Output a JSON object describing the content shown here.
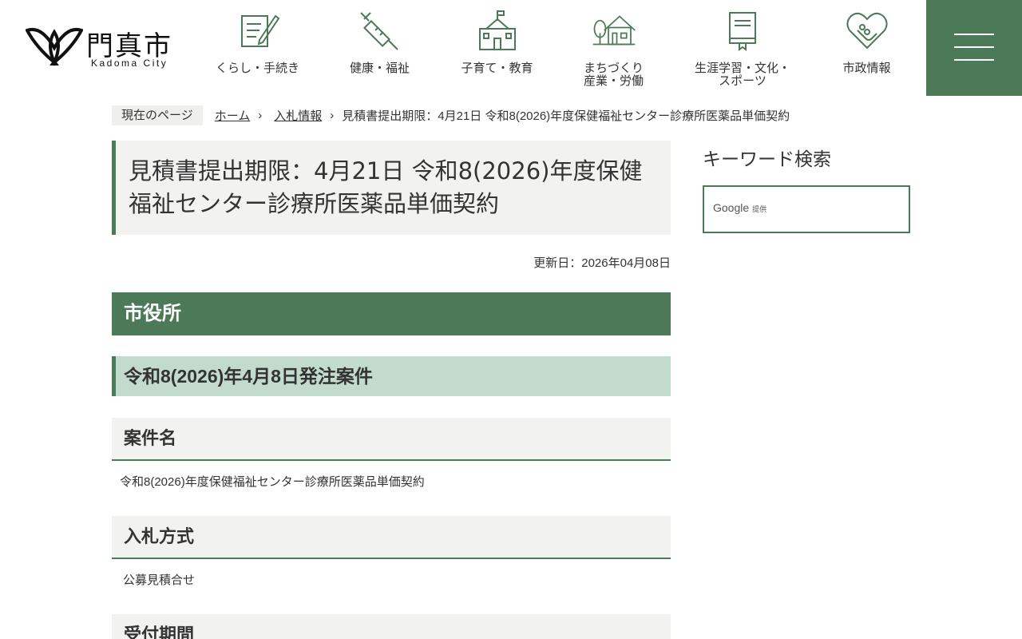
{
  "header": {
    "logo_jp": "門真市",
    "logo_en": "Kadoma City",
    "nav": [
      {
        "label": "くらし・手続き",
        "icon": "form-pen-icon"
      },
      {
        "label": "健康・福祉",
        "icon": "syringe-icon"
      },
      {
        "label": "子育て・教育",
        "icon": "school-icon"
      },
      {
        "label": "まちづくり\n産業・労働",
        "icon": "house-tree-icon"
      },
      {
        "label": "生涯学習・文化・\nスポーツ",
        "icon": "book-icon"
      },
      {
        "label": "市政情報",
        "icon": "heart-handshake-icon"
      }
    ],
    "menu_icon": "hamburger-menu-icon"
  },
  "breadcrumb": {
    "current_label": "現在のページ",
    "home": "ホーム",
    "parent": "入札情報",
    "current": "見積書提出期限：4月21日 令和8(2026)年度保健福祉センター診療所医薬品単価契約",
    "separator": "›"
  },
  "main": {
    "title": "見積書提出期限：4月21日 令和8(2026)年度保健福祉センター診療所医薬品単価契約",
    "updated": "更新日：2026年04月08日",
    "h2": "市役所",
    "h3": "令和8(2026)年4月8日発注案件",
    "sections": [
      {
        "heading": "案件名",
        "text": "令和8(2026)年度保健福祉センター診療所医薬品単価契約"
      },
      {
        "heading": "入札方式",
        "text": "公募見積合せ"
      },
      {
        "heading": "受付期間",
        "text": ""
      }
    ]
  },
  "sidebar": {
    "title": "キーワード検索",
    "search_google": "Google",
    "search_provided": "提供"
  },
  "colors": {
    "accent": "#4c7a58",
    "light_green": "#c2dbcd",
    "light_gray": "#f2f2f0"
  }
}
